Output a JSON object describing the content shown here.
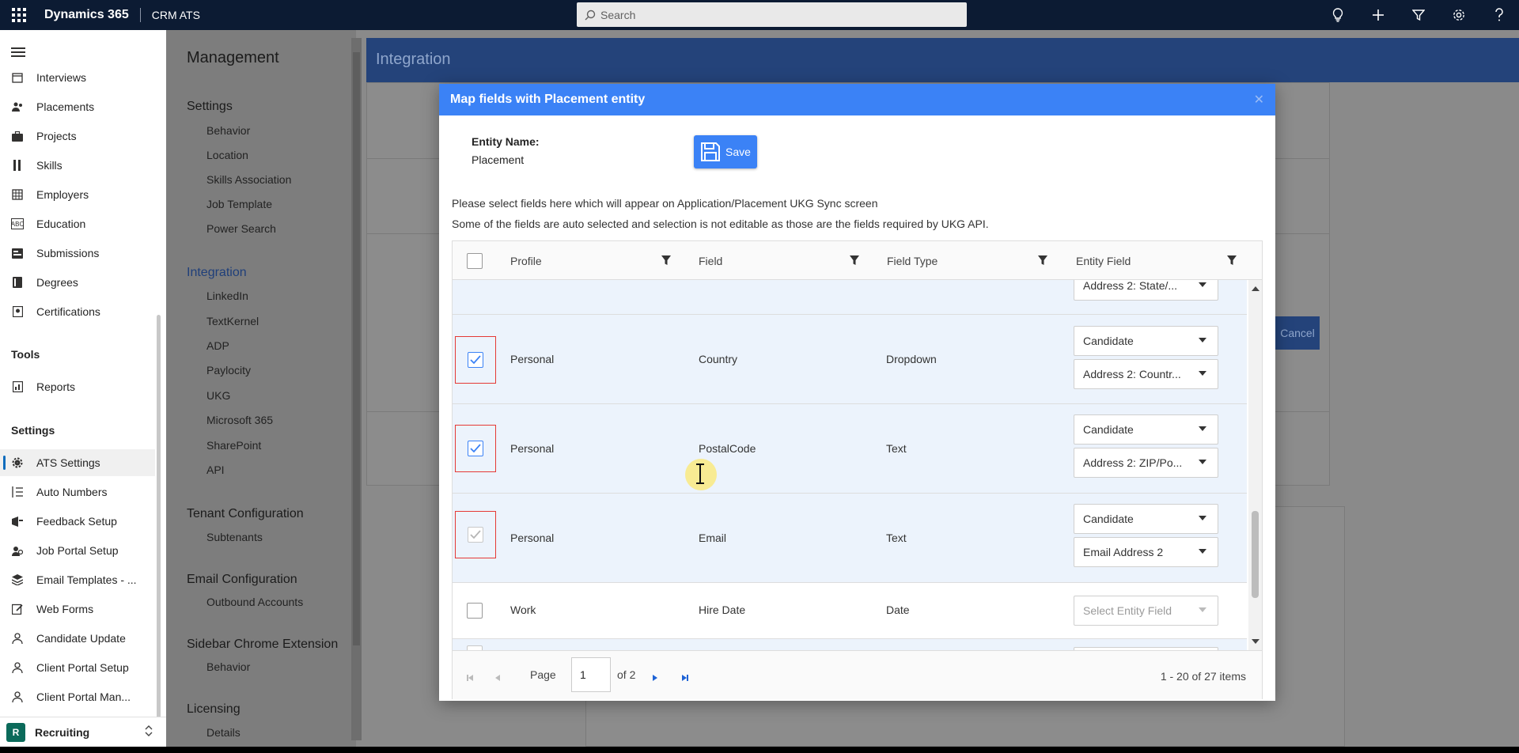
{
  "topbar": {
    "app_name": "Dynamics 365",
    "app_sub": "CRM ATS",
    "search_placeholder": "Search",
    "icons": [
      "lightbulb-icon",
      "plus-icon",
      "filter-icon",
      "gear-icon",
      "help-icon"
    ]
  },
  "sidebar": {
    "items": [
      {
        "label": "Interviews",
        "icon": "calendar-icon"
      },
      {
        "label": "Placements",
        "icon": "people-icon"
      },
      {
        "label": "Projects",
        "icon": "briefcase-icon"
      },
      {
        "label": "Skills",
        "icon": "tools-icon"
      },
      {
        "label": "Employers",
        "icon": "building-icon"
      },
      {
        "label": "Education",
        "icon": "abc-icon"
      },
      {
        "label": "Submissions",
        "icon": "submission-icon"
      },
      {
        "label": "Degrees",
        "icon": "book-icon"
      },
      {
        "label": "Certifications",
        "icon": "certificate-icon"
      }
    ],
    "tools_header": "Tools",
    "tools_items": [
      {
        "label": "Reports",
        "icon": "report-icon"
      }
    ],
    "settings_header": "Settings",
    "settings_items": [
      {
        "label": "ATS Settings",
        "icon": "gear-icon",
        "active": true
      },
      {
        "label": "Auto Numbers",
        "icon": "list-icon"
      },
      {
        "label": "Feedback Setup",
        "icon": "feedback-icon"
      },
      {
        "label": "Job Portal Setup",
        "icon": "portal-icon"
      },
      {
        "label": "Email Templates - ...",
        "icon": "layers-icon"
      },
      {
        "label": "Web Forms",
        "icon": "form-icon"
      },
      {
        "label": "Candidate Update",
        "icon": "person-icon"
      },
      {
        "label": "Client Portal Setup",
        "icon": "person-icon"
      },
      {
        "label": "Client Portal Man...",
        "icon": "person-icon"
      }
    ],
    "area_badge": "R",
    "area_label": "Recruiting"
  },
  "management": {
    "title": "Management",
    "sections": [
      {
        "header": "Settings",
        "items": [
          "Behavior",
          "Location",
          "Skills Association",
          "Job Template",
          "Power Search"
        ]
      },
      {
        "header": "Integration",
        "items": [
          "LinkedIn",
          "TextKernel",
          "ADP",
          "Paylocity",
          "UKG",
          "Microsoft 365",
          "SharePoint",
          "API"
        ]
      },
      {
        "header": "Tenant Configuration",
        "items": [
          "Subtenants"
        ]
      },
      {
        "header": "Email Configuration",
        "items": [
          "Outbound Accounts"
        ]
      },
      {
        "header": "Sidebar Chrome Extension",
        "items": [
          "Behavior"
        ]
      },
      {
        "header": "Licensing",
        "items": [
          "Details"
        ]
      }
    ]
  },
  "page": {
    "title": "Integration",
    "cancel_label": "Cancel"
  },
  "modal": {
    "title": "Map fields with Placement entity",
    "entity_label": "Entity Name:",
    "entity_value": "Placement",
    "save_label": "Save",
    "instruction_1": "Please select fields here which will appear on Application/Placement UKG Sync screen",
    "instruction_2": "Some of the fields are auto selected and selection is not editable as those are the fields required by UKG API.",
    "columns": [
      "Profile",
      "Field",
      "Field Type",
      "Entity Field"
    ],
    "partial_top_value": "Address 2: State/...",
    "rows": [
      {
        "profile": "Personal",
        "field": "Country",
        "type": "Dropdown",
        "entity": "Candidate",
        "entity_field": "Address 2: Countr...",
        "checked": true,
        "disabled": false
      },
      {
        "profile": "Personal",
        "field": "PostalCode",
        "type": "Text",
        "entity": "Candidate",
        "entity_field": "Address 2: ZIP/Po...",
        "checked": true,
        "disabled": false
      },
      {
        "profile": "Personal",
        "field": "Email",
        "type": "Text",
        "entity": "Candidate",
        "entity_field": "Email Address 2",
        "checked": true,
        "disabled": true
      },
      {
        "profile": "Work",
        "field": "Hire Date",
        "type": "Date",
        "entity": "",
        "entity_field": "Select Entity Field",
        "checked": false,
        "disabled": false
      }
    ],
    "pager": {
      "page_label": "Page",
      "page_value": "1",
      "of_label": "of 2",
      "items_label": "1 - 20 of 27 items"
    }
  }
}
